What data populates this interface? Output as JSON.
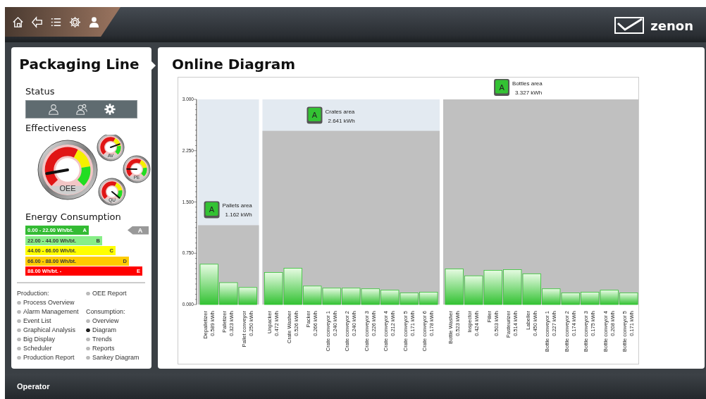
{
  "toolbar": [
    {
      "kind": "home"
    },
    {
      "kind": "back"
    },
    {
      "kind": "list"
    },
    {
      "kind": "settings"
    },
    {
      "kind": "user"
    }
  ],
  "logo": {
    "text": "zenon"
  },
  "sidebar": {
    "title": "Packaging Line",
    "status": {
      "heading": "Status",
      "items": [
        {
          "kind": "user",
          "selected": false
        },
        {
          "kind": "users",
          "selected": false
        },
        {
          "kind": "settings",
          "selected": true
        }
      ]
    },
    "effectiveness": {
      "heading": "Effectiveness",
      "gauges": [
        {
          "label": "OEE"
        },
        {
          "label": "AV"
        },
        {
          "label": "PE"
        },
        {
          "label": "QU"
        }
      ]
    },
    "energy": {
      "heading": "Energy Consumption",
      "indicator": "A",
      "classes": [
        {
          "range": "0.00 - 22.00 Wh/bt.",
          "letter": "A",
          "color": "#33bb33",
          "selected": true
        },
        {
          "range": "22.00 - 44.00 Wh/bt.",
          "letter": "B",
          "color": "#88ee88",
          "selected": false
        },
        {
          "range": "44.00 - 66.00 Wh/bt.",
          "letter": "C",
          "color": "#ffff00",
          "selected": false
        },
        {
          "range": "66.00 - 88.00 Wh/bt.",
          "letter": "D",
          "color": "#ffcc00",
          "selected": false
        },
        {
          "range": "88.00 Wh/bt. -",
          "letter": "E",
          "color": "#ff0000",
          "selected": false
        }
      ]
    },
    "nav": [
      {
        "items": [
          {
            "kind": "header",
            "label": "Production:"
          },
          {
            "kind": "link",
            "label": "Process Overview",
            "selected": false
          },
          {
            "kind": "link",
            "label": "Alarm Management",
            "selected": false
          },
          {
            "kind": "link",
            "label": "Event List",
            "selected": false
          },
          {
            "kind": "link",
            "label": "Graphical Analysis",
            "selected": false
          },
          {
            "kind": "link",
            "label": "Big Display",
            "selected": false
          },
          {
            "kind": "link",
            "label": "Scheduler",
            "selected": false
          },
          {
            "kind": "link",
            "label": "Production Report",
            "selected": false
          }
        ]
      },
      {
        "items": [
          {
            "kind": "link",
            "label": "OEE Report",
            "selected": false
          },
          {
            "kind": "gap"
          },
          {
            "kind": "header",
            "label": "Consumption:"
          },
          {
            "kind": "link",
            "label": "Overview",
            "selected": false
          },
          {
            "kind": "link",
            "label": "Diagram",
            "selected": true
          },
          {
            "kind": "link",
            "label": "Trends",
            "selected": false
          },
          {
            "kind": "link",
            "label": "Reports",
            "selected": false
          },
          {
            "kind": "link",
            "label": "Sankey Diagram",
            "selected": false
          }
        ]
      }
    ]
  },
  "main": {
    "title": "Online Diagram",
    "areas": [
      {
        "total": "1.162 kWh",
        "rating": "A"
      },
      {
        "total": "2.641 kWh",
        "rating": "A"
      },
      {
        "total": "3.327 kWh",
        "rating": "A"
      }
    ],
    "chart_data": {
      "type": "bar",
      "legend": "upper left",
      "ylim": [
        0,
        3
      ],
      "yticks": [
        {
          "value": 0,
          "label": "0.000"
        },
        {
          "value": 0.75,
          "label": "0.750"
        },
        {
          "value": 1.5,
          "label": "1.500"
        },
        {
          "value": 2.25,
          "label": "2.250"
        },
        {
          "value": 3,
          "label": "3.000"
        }
      ],
      "categories": [
        "Depalletizer",
        "Palletizer",
        "Pallet conveyor",
        "Unpacker",
        "Crate Washer",
        "Packer",
        "Crate conveyor 1",
        "Crate conveyor 2",
        "Crate conveyor 3",
        "Crate conveyor 4",
        "Crate conveyor 5",
        "Crate conveyor 6",
        "Bottle Washer",
        "Inspector",
        "Filler",
        "Pasteurizer",
        "Labeller",
        "Bottle conveyor 1",
        "Bottle conveyor 2",
        "Bottle conveyor 3",
        "Bottle conveyor 4",
        "Bottle conveyor 5"
      ],
      "value_labels": [
        "0.589 kWh",
        "0.323 kWh",
        "0.250 kWh",
        "0.472 kWh",
        "0.526 kWh",
        "0.266 kWh",
        "0.240 kWh",
        "0.240 kWh",
        "0.226 kWh",
        "0.212 kWh",
        "0.171 kWh",
        "0.178 kWh",
        "0.523 kWh",
        "0.424 kWh",
        "0.503 kWh",
        "0.514 kWh",
        "0.450 kWh",
        "0.227 kWh",
        "0.174 kWh",
        "0.175 kWh",
        "0.208 kWh",
        "0.171 kWh"
      ],
      "series": [
        {
          "name": "Pallets area",
          "color": "#33c233",
          "values": [
            0.59,
            0.32,
            0.25,
            null,
            null,
            null,
            null,
            null,
            null,
            null,
            null,
            null,
            null,
            null,
            null,
            null,
            null,
            null,
            null,
            null,
            null,
            null
          ]
        },
        {
          "name": "Crates area",
          "color": "#33c233",
          "values": [
            null,
            null,
            null,
            0.47,
            0.53,
            0.27,
            0.24,
            0.24,
            0.23,
            0.21,
            0.17,
            0.18,
            null,
            null,
            null,
            null,
            null,
            null,
            null,
            null,
            null,
            null
          ]
        },
        {
          "name": "Bottles area",
          "color": "#33c233",
          "values": [
            null,
            null,
            null,
            null,
            null,
            null,
            null,
            null,
            null,
            null,
            null,
            null,
            0.52,
            0.42,
            0.5,
            0.51,
            0.45,
            0.23,
            0.17,
            0.18,
            0.21,
            0.17
          ]
        }
      ]
    }
  },
  "status_bar": {
    "user": "Operator"
  }
}
